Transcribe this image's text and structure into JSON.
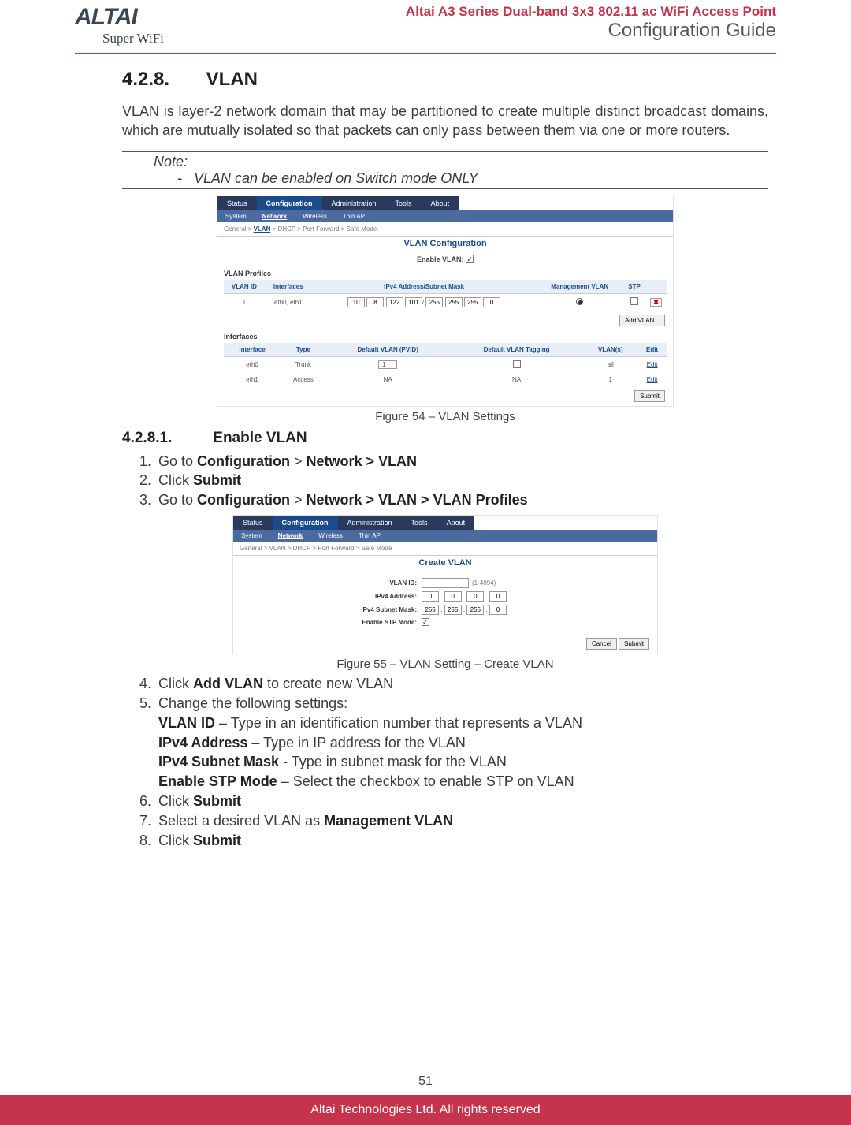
{
  "header": {
    "logo_main": "ALTAI",
    "logo_sub": "Super WiFi",
    "title1": "Altai A3 Series Dual-band 3x3 802.11 ac WiFi Access Point",
    "title2": "Configuration Guide"
  },
  "section": {
    "num": "4.2.8.",
    "title": "VLAN",
    "para": "VLAN is layer-2 network domain that may be partitioned to create multiple distinct broadcast domains, which are mutually isolated so that packets can only pass between them via one or more routers."
  },
  "note": {
    "label": "Note:",
    "text": "VLAN can be enabled on Switch mode ONLY"
  },
  "fig1": {
    "caption": "Figure 54 – VLAN Settings",
    "tabs": [
      "Status",
      "Configuration",
      "Administration",
      "Tools",
      "About"
    ],
    "active_tab_idx": 1,
    "subtabs": [
      "System",
      "Network",
      "Wireless",
      "Thin AP"
    ],
    "active_subtab_idx": 1,
    "crumbs": [
      "General",
      ">",
      "VLAN",
      ">",
      "DHCP",
      ">",
      "Port Forward",
      ">",
      "Safe Mode"
    ],
    "conf_title": "VLAN Configuration",
    "enable_label": "Enable VLAN:",
    "profiles_label": "VLAN Profiles",
    "prof_headers": [
      "VLAN ID",
      "Interfaces",
      "IPv4 Address/Subnet Mask",
      "Management VLAN",
      "STP",
      ""
    ],
    "prof_row": {
      "id": "1",
      "ifaces": "eth0, eth1",
      "ip": [
        "10",
        "8",
        "122",
        "101"
      ],
      "mask": [
        "255",
        "255",
        "255",
        "0"
      ]
    },
    "add_btn": "Add VLAN...",
    "ifaces_label": "Interfaces",
    "iface_headers": [
      "Interface",
      "Type",
      "Default VLAN (PVID)",
      "Default VLAN Tagging",
      "VLAN(s)",
      "Edit"
    ],
    "iface_rows": [
      {
        "if": "eth0",
        "type": "Trunk",
        "pvid": "1",
        "tag": "cb",
        "vlans": "all",
        "edit": "Edit"
      },
      {
        "if": "eth1",
        "type": "Access",
        "pvid": "NA",
        "tag": "NA",
        "vlans": "1",
        "edit": "Edit"
      }
    ],
    "submit": "Submit"
  },
  "subsection": {
    "num": "4.2.8.1.",
    "title": "Enable VLAN"
  },
  "steps": {
    "s1_a": "Go to ",
    "s1_b": "Configuration",
    "s1_c": " > ",
    "s1_d": "Network > VLAN",
    "s2_a": "Click ",
    "s2_b": "Submit",
    "s3_a": "Go to ",
    "s3_b": "Configuration",
    "s3_c": " > ",
    "s3_d": "Network > VLAN > VLAN Profiles",
    "s4_a": "Click ",
    "s4_b": "Add VLAN",
    "s4_c": " to create new VLAN",
    "s5_a": "Change the following settings:",
    "s5_r1_b": "VLAN ID",
    "s5_r1_t": " – Type in an identification number that represents a VLAN",
    "s5_r2_b": "IPv4 Address",
    "s5_r2_t": " – Type in IP address for the VLAN",
    "s5_r3_b": "IPv4 Subnet Mask",
    "s5_r3_t": " - Type in subnet mask for the VLAN",
    "s5_r4_b": "Enable STP Mode",
    "s5_r4_t": " – Select the checkbox to enable STP on VLAN",
    "s6_a": "Click ",
    "s6_b": "Submit",
    "s7_a": "Select a desired VLAN as ",
    "s7_b": "Management VLAN",
    "s8_a": "Click ",
    "s8_b": "Submit"
  },
  "fig2": {
    "caption": "Figure 55 – VLAN Setting – Create VLAN",
    "tabs": [
      "Status",
      "Configuration",
      "Administration",
      "Tools",
      "About"
    ],
    "subtabs": [
      "System",
      "Network",
      "Wireless",
      "Thin AP"
    ],
    "crumbs": [
      "General",
      ">",
      "VLAN",
      ">",
      "DHCP",
      ">",
      "Port Forward",
      ">",
      "Safe Mode"
    ],
    "conf_title": "Create VLAN",
    "rows": {
      "id_lbl": "VLAN ID:",
      "id_range": "(1-4094)",
      "ip_lbl": "IPv4 Address:",
      "ip": [
        "0",
        "0",
        "0",
        "0"
      ],
      "mask_lbl": "IPv4 Subnet Mask:",
      "mask": [
        "255",
        "255",
        "255",
        "0"
      ],
      "stp_lbl": "Enable STP Mode:"
    },
    "cancel": "Cancel",
    "submit": "Submit"
  },
  "footer": {
    "page": "51",
    "copyright": "Altai Technologies Ltd. All rights reserved"
  }
}
